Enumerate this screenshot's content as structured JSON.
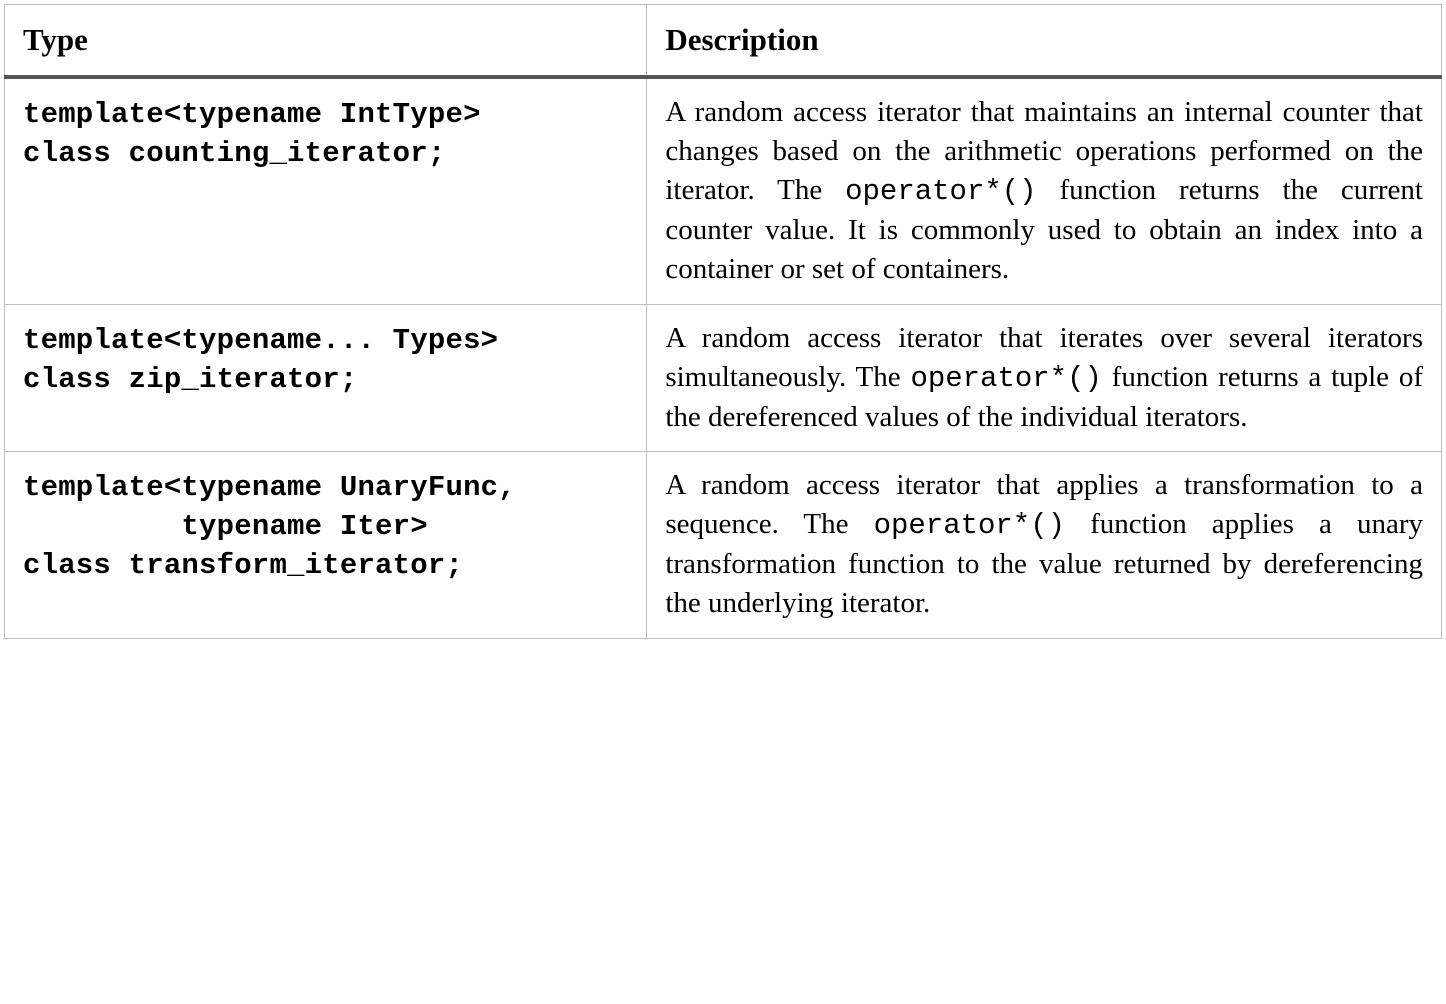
{
  "header": {
    "type": "Type",
    "description": "Description"
  },
  "rows": [
    {
      "code": "template<typename IntType>\nclass counting_iterator;",
      "description": {
        "pre": "A random access iterator that maintains an internal counter that changes based on the arithmetic operations performed on the iterator. The ",
        "op": "operator*()",
        "post": " function returns the current counter value. It is commonly used to obtain an index into a container or set of containers."
      }
    },
    {
      "code": "template<typename... Types>\nclass zip_iterator;",
      "description": {
        "pre": "A random access iterator that iterates over several iterators simultaneously. The ",
        "op": "operator*()",
        "post": " function returns a tuple of the dereferenced values of the individual iterators."
      }
    },
    {
      "code": "template<typename UnaryFunc,\n         typename Iter>\nclass transform_iterator;",
      "description": {
        "pre": "A random access iterator that applies a transformation to a sequence. The ",
        "op": "operator*()",
        "post": " function applies a unary transformation function to the value returned by dereferencing the underlying iterator."
      }
    }
  ]
}
